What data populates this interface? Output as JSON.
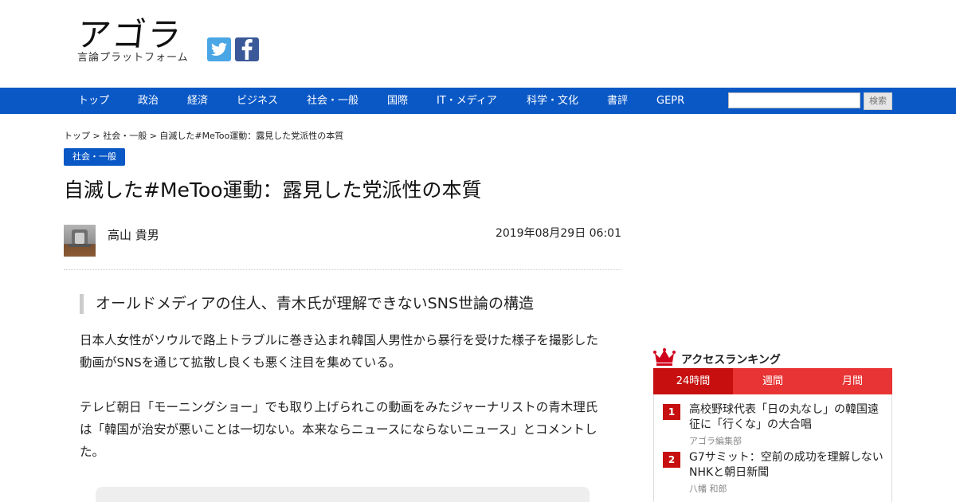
{
  "header": {
    "logo_main": "アゴラ",
    "logo_sub": "言論プラットフォーム"
  },
  "social": {
    "twitter_icon": "twitter-icon",
    "facebook_icon": "facebook-icon"
  },
  "nav": {
    "items": [
      "トップ",
      "政治",
      "経済",
      "ビジネス",
      "社会・一般",
      "国際",
      "IT・メディア",
      "科学・文化",
      "書評",
      "GEPR"
    ],
    "search_placeholder": "",
    "search_button": "検索"
  },
  "article": {
    "breadcrumb": "トップ > 社会・一般 > 自滅した#MeToo運動：露見した党派性の本質",
    "category": "社会・一般",
    "title": "自滅した#MeToo運動：露見した党派性の本質",
    "author": "高山 貴男",
    "date": "2019年08月29日 06:01",
    "subtitle": "オールドメディアの住人、青木氏が理解できないSNS世論の構造",
    "paragraphs": [
      "日本人女性がソウルで路上トラブルに巻き込まれ韓国人男性から暴行を受けた様子を撮影した動画がSNSを通じて拡散し良くも悪く注目を集めている。",
      "テレビ朝日「モーニングショー」でも取り上げられこの動画をみたジャーナリストの青木理氏は「韓国が治安が悪いことは一切ない。本来ならニュースにならないニュース」とコメントした。"
    ]
  },
  "ranking": {
    "title": "アクセスランキング",
    "crown_icon": "crown-icon",
    "tabs": [
      "24時間",
      "週間",
      "月間"
    ],
    "items": [
      {
        "rank": "1",
        "title": "高校野球代表「日の丸なし」の韓国遠征に「行くな」の大合唱",
        "author": "アゴラ編集部"
      },
      {
        "rank": "2",
        "title": "G7サミット：空前の成功を理解しないNHKと朝日新聞",
        "author": "八幡 和郎"
      }
    ]
  },
  "colors": {
    "brand_blue": "#0a58c6",
    "ranking_red": "#c70f0f",
    "tab_red": "#e83434"
  }
}
